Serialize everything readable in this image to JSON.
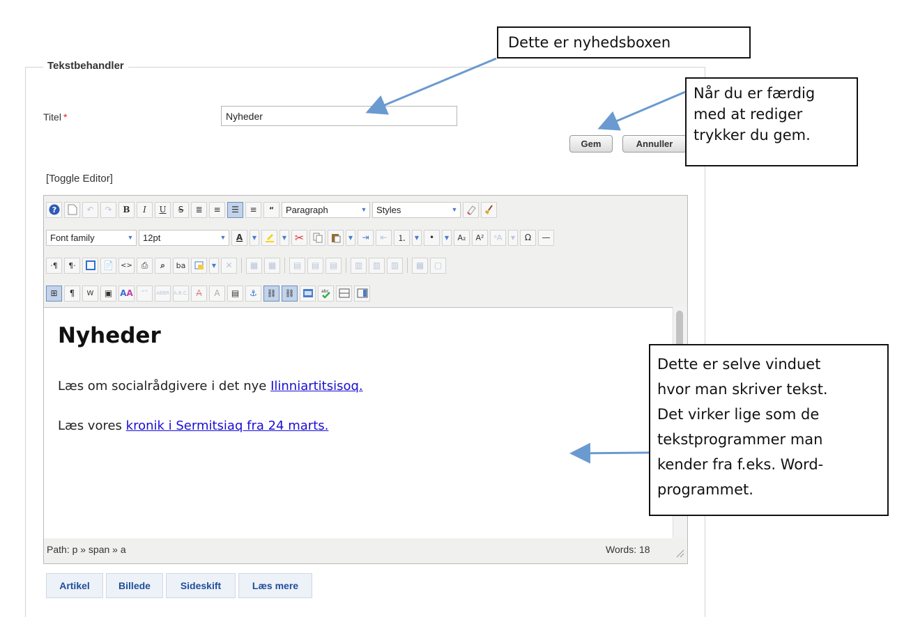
{
  "form": {
    "legend": "Tekstbehandler",
    "title_label": "Titel",
    "required_mark": "*",
    "title_value": "Nyheder",
    "save_label": "Gem",
    "cancel_label": "Annuller",
    "toggle_editor": "[Toggle Editor]"
  },
  "editor": {
    "toolbar": {
      "format_select": "Paragraph",
      "styles_select": "Styles",
      "font_family_select": "Font family",
      "font_size_select": "12pt"
    },
    "content": {
      "heading": "Nyheder",
      "p1_text": "Læs om socialrådgivere i det nye ",
      "p1_link": "Ilinniartitsisoq.",
      "p2_text": "Læs vores ",
      "p2_link": "kronik i Sermitsiaq fra 24 marts."
    },
    "status": {
      "path": "Path:  p » span » a",
      "words": "Words: 18"
    }
  },
  "page_buttons": [
    "Artikel",
    "Billede",
    "Sideskift",
    "Læs mere"
  ],
  "callouts": {
    "newsbox": "Dette er nyhedsboxen",
    "save_hint_lines": [
      "Når du er færdig",
      "med at rediger",
      "trykker du gem."
    ],
    "editor_hint_lines": [
      "Dette er selve vinduet",
      "hvor man skriver tekst.",
      "Det virker lige som de",
      "tekstprogrammer man",
      "kender fra f.eks. Word-",
      "programmet."
    ]
  },
  "colors": {
    "link": "#1a0dd6",
    "arrow": "#6a9ad0",
    "page_button_text": "#1f4f98"
  }
}
